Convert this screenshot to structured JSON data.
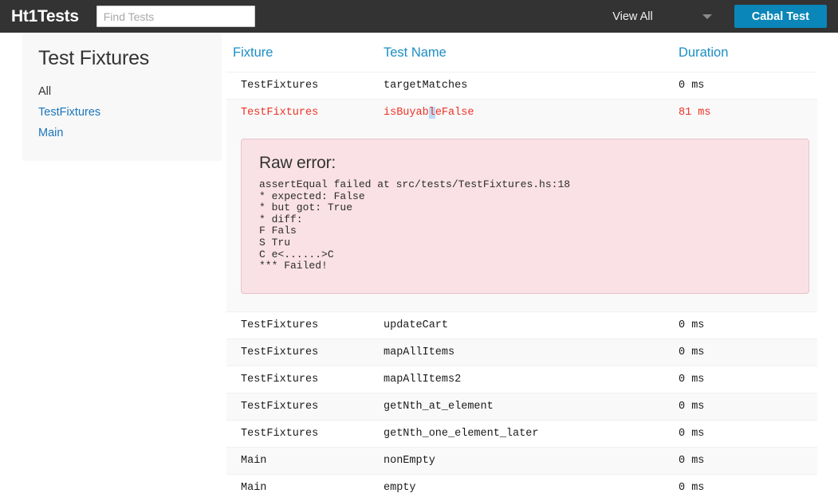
{
  "topbar": {
    "brand": "Ht1Tests",
    "search": {
      "placeholder": "Find Tests",
      "value": ""
    },
    "view_select": {
      "label": "View All",
      "caret_icon": "chevron-down-icon"
    },
    "run_button": "Cabal Test",
    "accent_color": "#0a86b8",
    "background_color": "#333333"
  },
  "sidebar": {
    "title": "Test Fixtures",
    "items": [
      {
        "label": "All",
        "active": true
      },
      {
        "label": "TestFixtures",
        "active": false
      },
      {
        "label": "Main",
        "active": false
      }
    ],
    "link_color": "#1b75bb"
  },
  "table": {
    "headers": {
      "fixture": "Fixture",
      "test_name": "Test Name",
      "duration": "Duration"
    },
    "header_color": "#1b8ec4",
    "fail_color": "#ee3124",
    "rows": [
      {
        "fixture": "TestFixtures",
        "test_name": "targetMatches",
        "duration": "0 ms",
        "failed": false
      },
      {
        "fixture": "TestFixtures",
        "test_name": "isBuyableFalse",
        "duration": "81 ms",
        "failed": true,
        "selection": {
          "before": "isBuyab",
          "selected": "l",
          "after": "eFalse"
        }
      },
      {
        "fixture": "TestFixtures",
        "test_name": "updateCart",
        "duration": "0 ms",
        "failed": false
      },
      {
        "fixture": "TestFixtures",
        "test_name": "mapAllItems",
        "duration": "0 ms",
        "failed": false
      },
      {
        "fixture": "TestFixtures",
        "test_name": "mapAllItems2",
        "duration": "0 ms",
        "failed": false
      },
      {
        "fixture": "TestFixtures",
        "test_name": "getNth_at_element",
        "duration": "0 ms",
        "failed": false
      },
      {
        "fixture": "TestFixtures",
        "test_name": "getNth_one_element_later",
        "duration": "0 ms",
        "failed": false
      },
      {
        "fixture": "Main",
        "test_name": "nonEmpty",
        "duration": "0 ms",
        "failed": false
      },
      {
        "fixture": "Main",
        "test_name": "empty",
        "duration": "0 ms",
        "failed": false
      }
    ]
  },
  "error_panel": {
    "title": "Raw error:",
    "body": "assertEqual failed at src/tests/TestFixtures.hs:18\n* expected: False\n* but got: True\n* diff:\nF Fals\nS Tru\nC e<......>C\n*** Failed!",
    "background_color": "#fae1e5",
    "border_color": "#e7c3cb"
  }
}
